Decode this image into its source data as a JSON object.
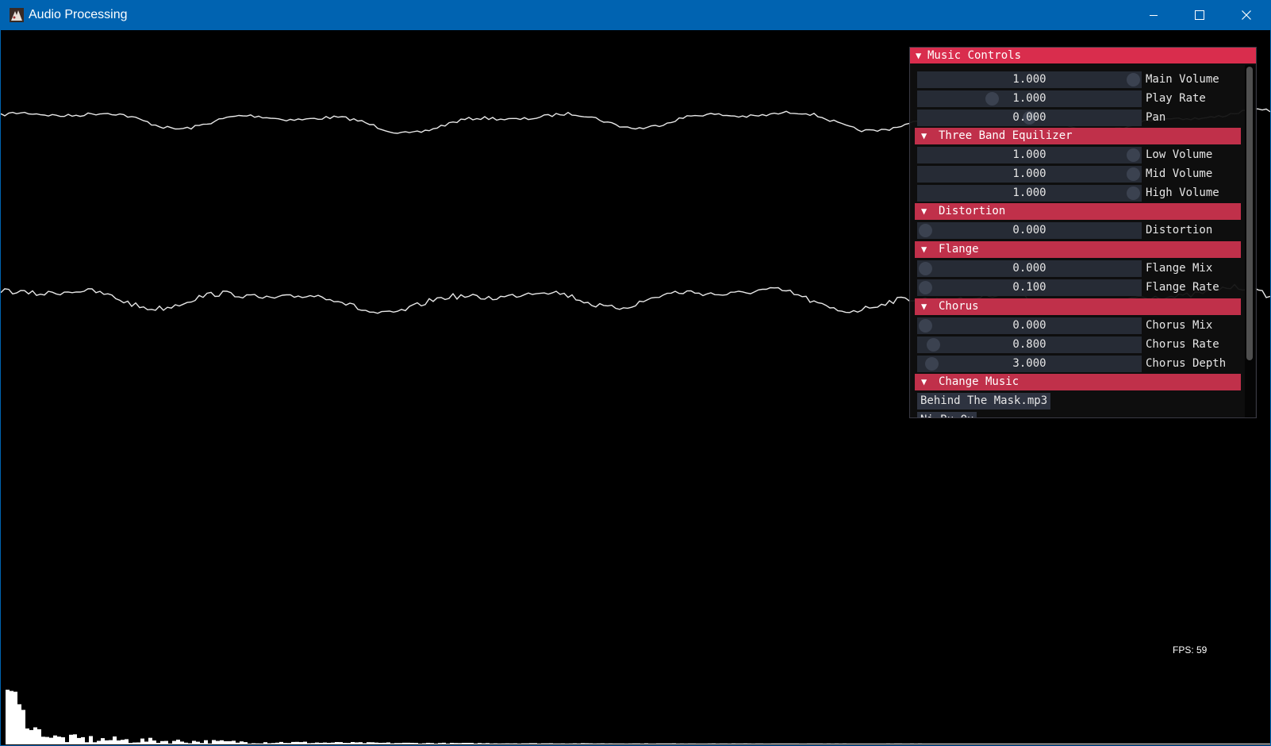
{
  "window": {
    "title": "Audio Processing"
  },
  "fps_text": "FPS: 59",
  "colors": {
    "accent": "#d92d4d",
    "header": "#c0304a",
    "titlebar": "#0063b1",
    "slider_bg": "#262b35"
  },
  "icons": {
    "app": "app-icon",
    "minimize": "minimize-icon",
    "maximize": "maximize-icon",
    "close": "close-icon",
    "collapse": "triangle-down-icon"
  },
  "panel": {
    "title": "Music Controls",
    "collapse_glyph": "▼",
    "sections": [
      {
        "controls": [
          {
            "label": "Main Volume",
            "value": "1.000",
            "fraction": 1.0
          },
          {
            "label": "Play Rate",
            "value": "1.000",
            "fraction": 0.32
          },
          {
            "label": "Pan",
            "value": "0.000",
            "fraction": 0.5
          }
        ]
      },
      {
        "title": "Three Band Equilizer",
        "controls": [
          {
            "label": "Low Volume",
            "value": "1.000",
            "fraction": 1.0
          },
          {
            "label": "Mid Volume",
            "value": "1.000",
            "fraction": 1.0
          },
          {
            "label": "High Volume",
            "value": "1.000",
            "fraction": 1.0
          }
        ]
      },
      {
        "title": "Distortion",
        "controls": [
          {
            "label": "Distortion",
            "value": "0.000",
            "fraction": 0.0
          }
        ]
      },
      {
        "title": "Flange",
        "controls": [
          {
            "label": "Flange Mix",
            "value": "0.000",
            "fraction": 0.0
          },
          {
            "label": "Flange Rate",
            "value": "0.100",
            "fraction": 0.0
          }
        ]
      },
      {
        "title": "Chorus",
        "controls": [
          {
            "label": "Chorus Mix",
            "value": "0.000",
            "fraction": 0.0
          },
          {
            "label": "Chorus Rate",
            "value": "0.800",
            "fraction": 0.04
          },
          {
            "label": "Chorus Depth",
            "value": "3.000",
            "fraction": 0.03
          }
        ]
      },
      {
        "title": "Change Music",
        "buttons": [
          "Behind The Mask.mp3",
          "Ni Bu Qu"
        ]
      }
    ]
  }
}
